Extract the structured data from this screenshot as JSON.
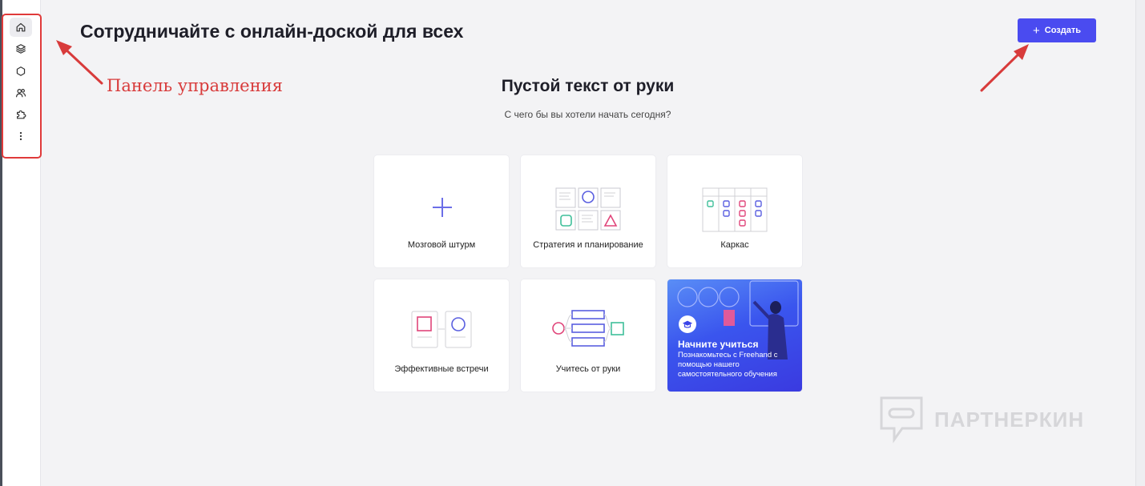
{
  "sidebar": {
    "items": [
      {
        "icon": "home-icon",
        "active": true
      },
      {
        "icon": "layers-icon",
        "active": false
      },
      {
        "icon": "hexagon-icon",
        "active": false
      },
      {
        "icon": "users-icon",
        "active": false
      },
      {
        "icon": "puzzle-icon",
        "active": false
      },
      {
        "icon": "more-vertical-icon",
        "active": false
      }
    ]
  },
  "annotation": {
    "text": "Панель управления",
    "color": "#d83b3b"
  },
  "header": {
    "title": "Сотрудничайте с онлайн-доской для всех",
    "create_label": "Создать",
    "create_color": "#4a4bf0"
  },
  "section": {
    "title": "Пустой текст от руки",
    "subtitle": "С чего бы вы хотели начать сегодня?"
  },
  "templates": [
    {
      "label": "Мозговой штурм",
      "icon": "plus-icon"
    },
    {
      "label": "Стратегия и планирование",
      "icon": "strategy-grid-icon"
    },
    {
      "label": "Каркас",
      "icon": "kanban-board-icon"
    },
    {
      "label": "Эффективные встречи",
      "icon": "meeting-cards-icon"
    },
    {
      "label": "Учитесь от руки",
      "icon": "flow-diagram-icon"
    }
  ],
  "learn_card": {
    "title": "Начните учиться",
    "description": "Познакомьтесь с Freehand с помощью нашего самостоятельного обучения",
    "icon": "graduation-cap-icon"
  },
  "watermark": {
    "text": "ПАРТНЕРКИН"
  }
}
